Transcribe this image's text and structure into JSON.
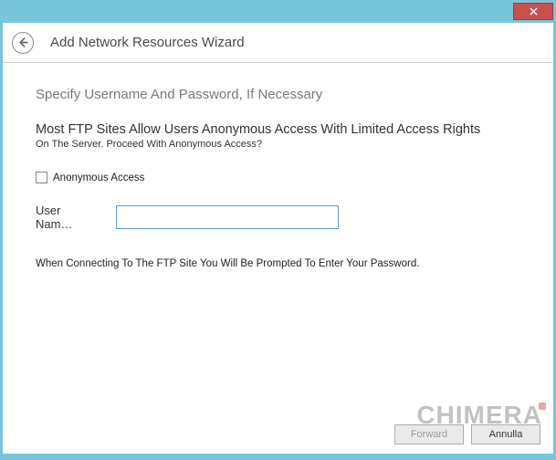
{
  "window": {
    "title": "Add Network Resources Wizard"
  },
  "step": {
    "title": "Specify Username And Password, If Necessary",
    "desc_title": "Most FTP Sites Allow Users Anonymous Access With Limited Access Rights",
    "desc_sub": "On The Server. Proceed With Anonymous Access?"
  },
  "anonymous": {
    "label": "Anonymous Access",
    "checked": false
  },
  "username": {
    "label": "User Nam…",
    "value": ""
  },
  "password_note": "When Connecting To The FTP Site You Will Be Prompted To Enter Your Password.",
  "buttons": {
    "forward": "Forward",
    "cancel": "Annulla"
  },
  "watermark": "CHIMERA"
}
